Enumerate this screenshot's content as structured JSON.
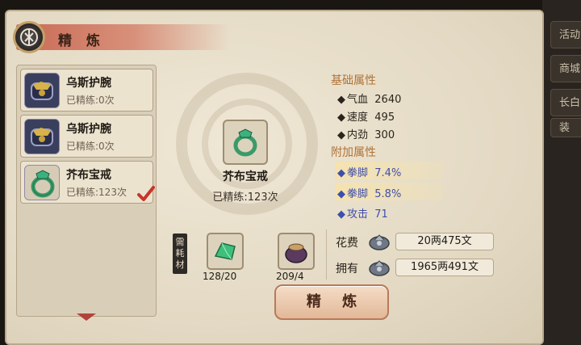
{
  "side_tabs": [
    "活动",
    "商城",
    "长白",
    "装"
  ],
  "header": {
    "title": "精 炼"
  },
  "item_list": [
    {
      "name": "乌斯护腕",
      "count": "已精练:0次",
      "icon": "bracer-icon"
    },
    {
      "name": "乌斯护腕",
      "count": "已精练:0次",
      "icon": "bracer-icon"
    },
    {
      "name": "芥布宝戒",
      "count": "已精练:123次",
      "icon": "ring-icon",
      "selected": true
    }
  ],
  "preview": {
    "name": "芥布宝戒",
    "count": "已精练:123次"
  },
  "base_attrs": {
    "title": "基础属性",
    "items": [
      {
        "label": "气血",
        "value": "2640"
      },
      {
        "label": "速度",
        "value": "495"
      },
      {
        "label": "内劲",
        "value": "300"
      }
    ]
  },
  "extra_attrs": {
    "title": "附加属性",
    "items": [
      {
        "label": "拳脚",
        "value": "7.4%"
      },
      {
        "label": "拳脚",
        "value": "5.8%"
      },
      {
        "label": "攻击",
        "value": "71"
      }
    ]
  },
  "materials": {
    "label": "需耗材",
    "items": [
      {
        "count": "128/20",
        "icon": "jade-icon"
      },
      {
        "count": "209/4",
        "icon": "pouch-icon"
      }
    ]
  },
  "cost": {
    "label": "花费",
    "value": "20两475文"
  },
  "own": {
    "label": "拥有",
    "value": "1965两491文"
  },
  "refine_button": "精 炼",
  "colors": {
    "accent": "#b07338",
    "extra_attr_blue": "#3e4fae",
    "title_bar": "#c96a55"
  }
}
